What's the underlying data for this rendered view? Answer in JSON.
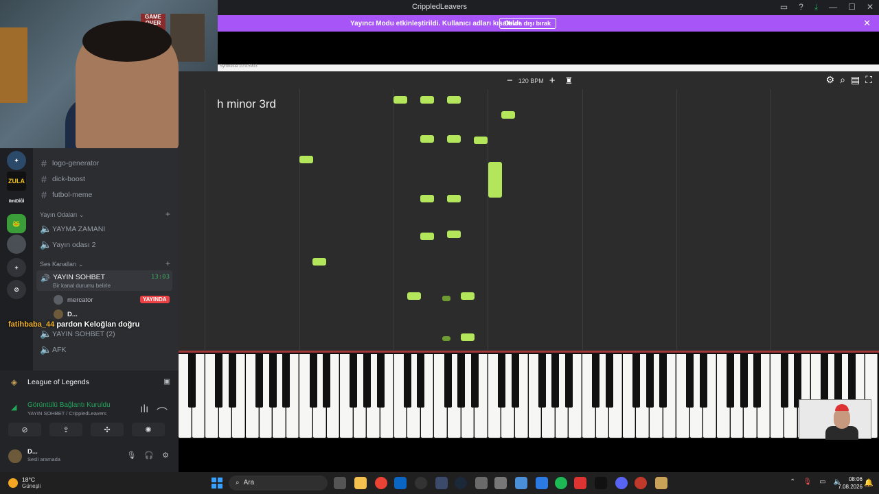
{
  "discord": {
    "window_title": "CrippledLeavers",
    "banner_text": "Yayıncı Modu etkinleştirildi. Kullanıcı adları kısaltıldı.",
    "banner_button": "Devre dışı bırak",
    "servers": [
      "ZULA",
      "ilmiDİĞİ"
    ],
    "channels": [
      {
        "label": "logo-generator",
        "type": "text"
      },
      {
        "label": "dick-boost",
        "type": "text"
      },
      {
        "label": "futbol-meme",
        "type": "text"
      }
    ],
    "stream_category": "Yayın Odaları",
    "stream_rooms": [
      "YAYMA ZAMANI",
      "Yayın odası 2"
    ],
    "voice_category": "Ses Kanalları",
    "active_voice": {
      "name": "YAYIN SOHBET",
      "status_placeholder": "Bir kanal durumu belirle",
      "time": "13:03",
      "users": [
        {
          "name": "mercator",
          "badge": "YAYINDA"
        },
        {
          "name": "D..."
        }
      ]
    },
    "voice_channels": [
      "YAYIN SOHBET (2)",
      "AFK"
    ],
    "chat_overlay": {
      "user": "fatihbaba_44",
      "message": "pardon Keloğlan doğru"
    },
    "activity": "League of Legends",
    "connection": {
      "title": "Görüntülü Bağlantı Kuruldu",
      "subtitle": "YAYIN SOHBET / CrippledLeavers"
    },
    "me": {
      "name": "D...",
      "status": "Sesli aramada"
    }
  },
  "webcam": {
    "poster_text": "GAME OVER"
  },
  "synthesia": {
    "title": "Synthesia 10.9.5903",
    "bpm": "120 BPM",
    "song_text": "h minor 3rd"
  },
  "taskbar": {
    "temperature": "18°C",
    "weather": "Güneşli",
    "search_placeholder": "Ara",
    "time": "08:06",
    "date": "7.08.2026"
  },
  "colors": {
    "note": "#b3e65a",
    "banner": "#a855f7",
    "live": "#ed4245",
    "voice_green": "#23a55a"
  }
}
